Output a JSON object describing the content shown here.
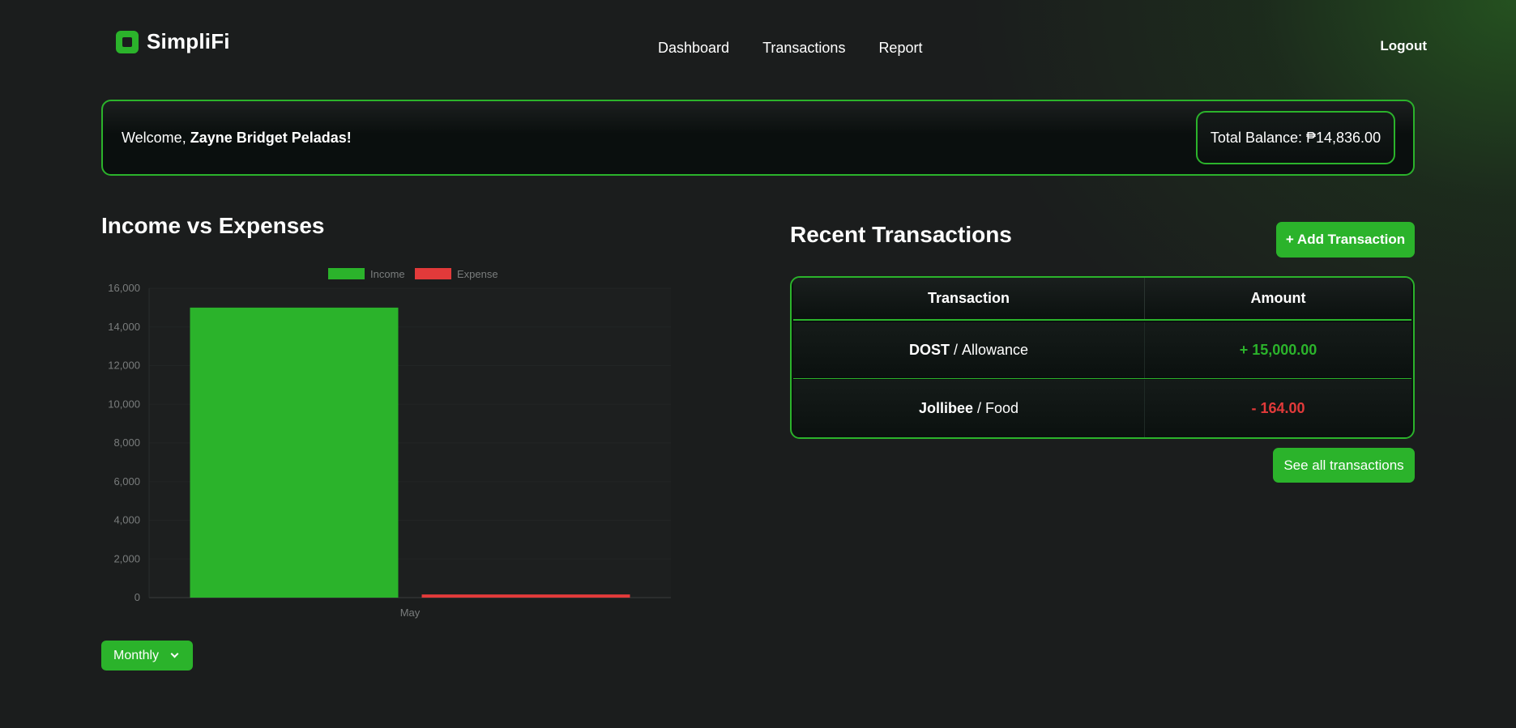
{
  "brand": {
    "name": "SimpliFi",
    "accent": "#2bb32b"
  },
  "nav": {
    "items": [
      "Dashboard",
      "Transactions",
      "Report"
    ],
    "logout": "Logout"
  },
  "welcome": {
    "greeting": "Welcome, ",
    "user_name": "Zayne Bridget Peladas!"
  },
  "balance": {
    "label": "Total Balance: ₱14,836.00"
  },
  "chart_section": {
    "title": "Income vs Expenses",
    "period_select": "Monthly"
  },
  "chart_data": {
    "type": "bar",
    "categories": [
      "May"
    ],
    "series": [
      {
        "name": "Income",
        "values": [
          15000
        ],
        "color": "#2bb32b"
      },
      {
        "name": "Expense",
        "values": [
          164
        ],
        "color": "#e23a3a"
      }
    ],
    "ylim": [
      0,
      16000
    ],
    "yticks": [
      "0",
      "2,000",
      "4,000",
      "6,000",
      "8,000",
      "10,000",
      "12,000",
      "14,000",
      "16,000"
    ],
    "legend": "top"
  },
  "recent": {
    "title": "Recent Transactions",
    "add_button": "+ Add Transaction",
    "headers": {
      "transaction": "Transaction",
      "amount": "Amount"
    },
    "rows": [
      {
        "name": "DOST",
        "sep": " / ",
        "category": "Allowance",
        "amount": "+ 15,000.00"
      },
      {
        "name": "Jollibee",
        "sep": " / ",
        "category": "Food",
        "amount": "- 164.00"
      }
    ],
    "see_all": "See all transactions"
  }
}
